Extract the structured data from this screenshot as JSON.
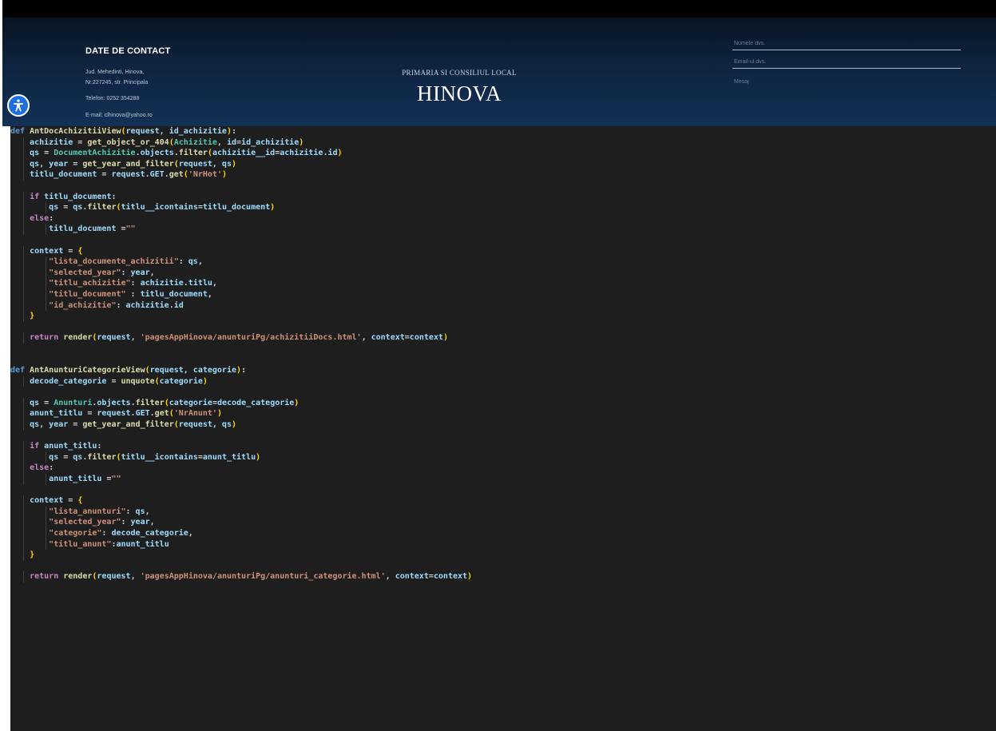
{
  "header": {
    "contact_title": "DATE DE CONTACT",
    "address_line1": "Jud. Mehedinti, Hinova,",
    "address_line2": "Nr.227245, str. Principala",
    "phone": "Telefon: 0252 354288",
    "email": "E-mail: clhinova@yahoo.ro",
    "brand_subtitle": "PRIMARIA SI CONSILIUL LOCAL",
    "brand_title": "HINOVA"
  },
  "form": {
    "name_placeholder": "Numele dvs.",
    "email_placeholder": "Email-ul dvs.",
    "message_placeholder": "Mesaj"
  },
  "accessibility": {
    "icon": "accessibility-icon",
    "color": "#1e6fe0"
  },
  "code_lines": [
    {
      "indent": 0,
      "tokens": [
        [
          "def",
          "def"
        ],
        [
          " ",
          ""
        ],
        [
          "AntDocAchizitiiView",
          "fn"
        ],
        [
          "(",
          "br"
        ],
        [
          "request, id_achizitie",
          "var"
        ],
        [
          ")",
          "br"
        ],
        [
          ":",
          ""
        ]
      ]
    },
    {
      "indent": 1,
      "tokens": [
        [
          "achizitie",
          "var"
        ],
        [
          " = ",
          ""
        ],
        [
          "get_object_or_404",
          "fn"
        ],
        [
          "(",
          "br"
        ],
        [
          "Achizitie",
          "cls"
        ],
        [
          ", ",
          ""
        ],
        [
          "id",
          "var"
        ],
        [
          "=",
          ""
        ],
        [
          "id_achizitie",
          "var"
        ],
        [
          ")",
          "br"
        ]
      ]
    },
    {
      "indent": 1,
      "tokens": [
        [
          "qs",
          "var"
        ],
        [
          " = ",
          ""
        ],
        [
          "DocumentAchizitie",
          "cls"
        ],
        [
          ".",
          ""
        ],
        [
          "objects",
          "var"
        ],
        [
          ".",
          ""
        ],
        [
          "filter",
          "fn"
        ],
        [
          "(",
          "br"
        ],
        [
          "achizitie__id",
          "var"
        ],
        [
          "=",
          ""
        ],
        [
          "achizitie",
          "var"
        ],
        [
          ".",
          ""
        ],
        [
          "id",
          "var"
        ],
        [
          ")",
          "br"
        ]
      ]
    },
    {
      "indent": 1,
      "tokens": [
        [
          "qs, year",
          "var"
        ],
        [
          " = ",
          ""
        ],
        [
          "get_year_and_filter",
          "fn"
        ],
        [
          "(",
          "br"
        ],
        [
          "request, qs",
          "var"
        ],
        [
          ")",
          "br"
        ]
      ]
    },
    {
      "indent": 1,
      "tokens": [
        [
          "titlu_document",
          "var"
        ],
        [
          " = ",
          ""
        ],
        [
          "request",
          "var"
        ],
        [
          ".",
          ""
        ],
        [
          "GET",
          "var"
        ],
        [
          ".",
          ""
        ],
        [
          "get",
          "fn"
        ],
        [
          "(",
          "br"
        ],
        [
          "'NrHot'",
          "str"
        ],
        [
          ")",
          "br"
        ]
      ]
    },
    {
      "indent": 0,
      "tokens": []
    },
    {
      "indent": 1,
      "tokens": [
        [
          "if",
          "kw"
        ],
        [
          " ",
          ""
        ],
        [
          "titlu_document",
          "var"
        ],
        [
          ":",
          ""
        ]
      ]
    },
    {
      "indent": 2,
      "tokens": [
        [
          "qs",
          "var"
        ],
        [
          " = ",
          ""
        ],
        [
          "qs",
          "var"
        ],
        [
          ".",
          ""
        ],
        [
          "filter",
          "fn"
        ],
        [
          "(",
          "br"
        ],
        [
          "titlu__icontains",
          "var"
        ],
        [
          "=",
          ""
        ],
        [
          "titlu_document",
          "var"
        ],
        [
          ")",
          "br"
        ]
      ]
    },
    {
      "indent": 1,
      "tokens": [
        [
          "else",
          "kw"
        ],
        [
          ":",
          ""
        ]
      ]
    },
    {
      "indent": 2,
      "tokens": [
        [
          "titlu_document",
          "var"
        ],
        [
          " =",
          ""
        ],
        [
          "\"\"",
          "str"
        ]
      ]
    },
    {
      "indent": 0,
      "tokens": []
    },
    {
      "indent": 1,
      "tokens": [
        [
          "context",
          "var"
        ],
        [
          " = ",
          ""
        ],
        [
          "{",
          "br"
        ]
      ]
    },
    {
      "indent": 2,
      "tokens": [
        [
          "\"lista_documente_achizitii\"",
          "str"
        ],
        [
          ": ",
          ""
        ],
        [
          "qs",
          "var"
        ],
        [
          ",",
          ""
        ]
      ]
    },
    {
      "indent": 2,
      "tokens": [
        [
          "\"selected_year\"",
          "str"
        ],
        [
          ": ",
          ""
        ],
        [
          "year",
          "var"
        ],
        [
          ",",
          ""
        ]
      ]
    },
    {
      "indent": 2,
      "tokens": [
        [
          "\"titlu_achizitie\"",
          "str"
        ],
        [
          ": ",
          ""
        ],
        [
          "achizitie",
          "var"
        ],
        [
          ".",
          ""
        ],
        [
          "titlu",
          "var"
        ],
        [
          ",",
          ""
        ]
      ]
    },
    {
      "indent": 2,
      "tokens": [
        [
          "\"titlu_document\"",
          "str"
        ],
        [
          " : ",
          ""
        ],
        [
          "titlu_document",
          "var"
        ],
        [
          ",",
          ""
        ]
      ]
    },
    {
      "indent": 2,
      "tokens": [
        [
          "\"id_achizitie\"",
          "str"
        ],
        [
          ": ",
          ""
        ],
        [
          "achizitie",
          "var"
        ],
        [
          ".",
          ""
        ],
        [
          "id",
          "var"
        ]
      ]
    },
    {
      "indent": 1,
      "tokens": [
        [
          "}",
          "br"
        ]
      ]
    },
    {
      "indent": 0,
      "tokens": []
    },
    {
      "indent": 1,
      "tokens": [
        [
          "return",
          "kw"
        ],
        [
          " ",
          ""
        ],
        [
          "render",
          "fn"
        ],
        [
          "(",
          "br"
        ],
        [
          "request",
          "var"
        ],
        [
          ", ",
          ""
        ],
        [
          "'pagesAppHinova/anunturiPg/achizitiiDocs.html'",
          "str"
        ],
        [
          ", ",
          ""
        ],
        [
          "context",
          "var"
        ],
        [
          "=",
          ""
        ],
        [
          "context",
          "var"
        ],
        [
          ")",
          "br"
        ]
      ]
    },
    {
      "indent": 0,
      "tokens": []
    },
    {
      "indent": 0,
      "tokens": []
    },
    {
      "indent": 0,
      "tokens": [
        [
          "def",
          "def"
        ],
        [
          " ",
          ""
        ],
        [
          "AntAnunturiCategorieView",
          "fn"
        ],
        [
          "(",
          "br"
        ],
        [
          "request, categorie",
          "var"
        ],
        [
          ")",
          "br"
        ],
        [
          ":",
          ""
        ]
      ]
    },
    {
      "indent": 1,
      "tokens": [
        [
          "decode_categorie",
          "var"
        ],
        [
          " = ",
          ""
        ],
        [
          "unquote",
          "fn"
        ],
        [
          "(",
          "br"
        ],
        [
          "categorie",
          "var"
        ],
        [
          ")",
          "br"
        ]
      ]
    },
    {
      "indent": 0,
      "tokens": []
    },
    {
      "indent": 1,
      "tokens": [
        [
          "qs",
          "var"
        ],
        [
          " = ",
          ""
        ],
        [
          "Anunturi",
          "cls"
        ],
        [
          ".",
          ""
        ],
        [
          "objects",
          "var"
        ],
        [
          ".",
          ""
        ],
        [
          "filter",
          "fn"
        ],
        [
          "(",
          "br"
        ],
        [
          "categorie",
          "var"
        ],
        [
          "=",
          ""
        ],
        [
          "decode_categorie",
          "var"
        ],
        [
          ")",
          "br"
        ]
      ]
    },
    {
      "indent": 1,
      "tokens": [
        [
          "anunt_titlu",
          "var"
        ],
        [
          " = ",
          ""
        ],
        [
          "request",
          "var"
        ],
        [
          ".",
          ""
        ],
        [
          "GET",
          "var"
        ],
        [
          ".",
          ""
        ],
        [
          "get",
          "fn"
        ],
        [
          "(",
          "br"
        ],
        [
          "'NrAnunt'",
          "str"
        ],
        [
          ")",
          "br"
        ]
      ]
    },
    {
      "indent": 1,
      "tokens": [
        [
          "qs, year",
          "var"
        ],
        [
          " = ",
          ""
        ],
        [
          "get_year_and_filter",
          "fn"
        ],
        [
          "(",
          "br"
        ],
        [
          "request, qs",
          "var"
        ],
        [
          ")",
          "br"
        ]
      ]
    },
    {
      "indent": 0,
      "tokens": []
    },
    {
      "indent": 1,
      "tokens": [
        [
          "if",
          "kw"
        ],
        [
          " ",
          ""
        ],
        [
          "anunt_titlu",
          "var"
        ],
        [
          ":",
          ""
        ]
      ]
    },
    {
      "indent": 2,
      "tokens": [
        [
          "qs",
          "var"
        ],
        [
          " = ",
          ""
        ],
        [
          "qs",
          "var"
        ],
        [
          ".",
          ""
        ],
        [
          "filter",
          "fn"
        ],
        [
          "(",
          "br"
        ],
        [
          "titlu__icontains",
          "var"
        ],
        [
          "=",
          ""
        ],
        [
          "anunt_titlu",
          "var"
        ],
        [
          ")",
          "br"
        ]
      ]
    },
    {
      "indent": 1,
      "tokens": [
        [
          "else",
          "kw"
        ],
        [
          ":",
          ""
        ]
      ]
    },
    {
      "indent": 2,
      "tokens": [
        [
          "anunt_titlu",
          "var"
        ],
        [
          " =",
          ""
        ],
        [
          "\"\"",
          "str"
        ]
      ]
    },
    {
      "indent": 0,
      "tokens": []
    },
    {
      "indent": 1,
      "tokens": [
        [
          "context",
          "var"
        ],
        [
          " = ",
          ""
        ],
        [
          "{",
          "br"
        ]
      ]
    },
    {
      "indent": 2,
      "tokens": [
        [
          "\"lista_anunturi\"",
          "str"
        ],
        [
          ": ",
          ""
        ],
        [
          "qs",
          "var"
        ],
        [
          ",",
          ""
        ]
      ]
    },
    {
      "indent": 2,
      "tokens": [
        [
          "\"selected_year\"",
          "str"
        ],
        [
          ": ",
          ""
        ],
        [
          "year",
          "var"
        ],
        [
          ",",
          ""
        ]
      ]
    },
    {
      "indent": 2,
      "tokens": [
        [
          "\"categorie\"",
          "str"
        ],
        [
          ": ",
          ""
        ],
        [
          "decode_categorie",
          "var"
        ],
        [
          ",",
          ""
        ]
      ]
    },
    {
      "indent": 2,
      "tokens": [
        [
          "\"titlu_anunt\"",
          "str"
        ],
        [
          ":",
          ""
        ],
        [
          "anunt_titlu",
          "var"
        ]
      ]
    },
    {
      "indent": 1,
      "tokens": [
        [
          "}",
          "br"
        ]
      ]
    },
    {
      "indent": 0,
      "tokens": []
    },
    {
      "indent": 1,
      "tokens": [
        [
          "return",
          "kw"
        ],
        [
          " ",
          ""
        ],
        [
          "render",
          "fn"
        ],
        [
          "(",
          "br"
        ],
        [
          "request",
          "var"
        ],
        [
          ", ",
          ""
        ],
        [
          "'pagesAppHinova/anunturiPg/anunturi_categorie.html'",
          "str"
        ],
        [
          ", ",
          ""
        ],
        [
          "context",
          "var"
        ],
        [
          "=",
          ""
        ],
        [
          "context",
          "var"
        ],
        [
          ")",
          "br"
        ]
      ]
    }
  ]
}
